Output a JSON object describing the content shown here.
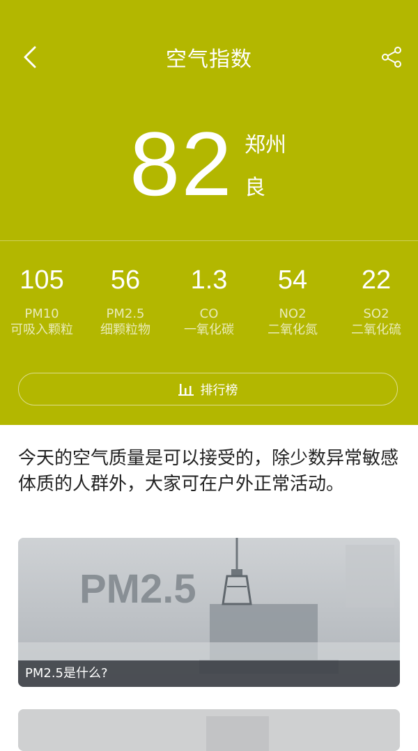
{
  "header": {
    "title": "空气指数"
  },
  "aqi": {
    "value": "82",
    "city": "郑州",
    "level": "良"
  },
  "metrics": [
    {
      "value": "105",
      "name": "PM10",
      "cn": "可吸入颗粒"
    },
    {
      "value": "56",
      "name": "PM2.5",
      "cn": "细颗粒物"
    },
    {
      "value": "1.3",
      "name": "CO",
      "cn": "一氧化碳"
    },
    {
      "value": "54",
      "name": "NO2",
      "cn": "二氧化氮"
    },
    {
      "value": "22",
      "name": "SO2",
      "cn": "二氧化硫"
    }
  ],
  "ranking": {
    "label": "排行榜"
  },
  "description": "今天的空气质量是可以接受的，除少数异常敏感体质的人群外，大家可在户外正常活动。",
  "articles": [
    {
      "title": "PM2.5是什么?",
      "image_text": "PM2.5"
    }
  ],
  "colors": {
    "theme": "#b3b700",
    "text_dark": "#222222"
  }
}
